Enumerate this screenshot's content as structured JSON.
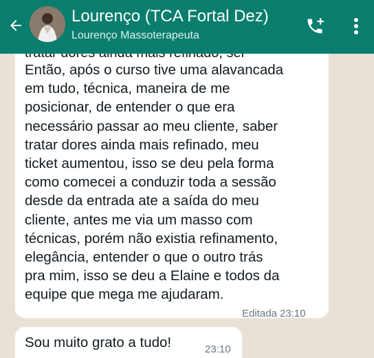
{
  "header": {
    "title": "Lourenço (TCA Fortal Dez)",
    "subtitle": "Lourenço Massoterapeuta",
    "color": "#0a7e6e"
  },
  "icons": {
    "back": "arrow-left-icon",
    "call": "add-call-icon",
    "menu": "more-vertical-icon"
  },
  "messages": [
    {
      "partial_top_line": "tratar dores ainda mais refinado, sei",
      "lines": [
        "Então, após o curso tive uma alavancada",
        "em tudo, técnica, maneira de me",
        "posicionar, de entender o que era",
        "necessário passar ao meu cliente, saber",
        "tratar dores ainda mais refinado, meu",
        "ticket aumentou, isso se deu pela forma",
        "como comecei a conduzir toda a sessão",
        "desde da entrada ate a saída do meu",
        "cliente, antes me via um masso com",
        "técnicas, porém não existia refinamento,",
        "elegância, entender o que o outro trás",
        "pra mim, isso se deu a Elaine e todos da",
        "equipe que mega me ajudaram."
      ],
      "meta": "Editada 23:10"
    },
    {
      "text": "Sou muito grato a tudo!",
      "time": "23:10"
    }
  ]
}
